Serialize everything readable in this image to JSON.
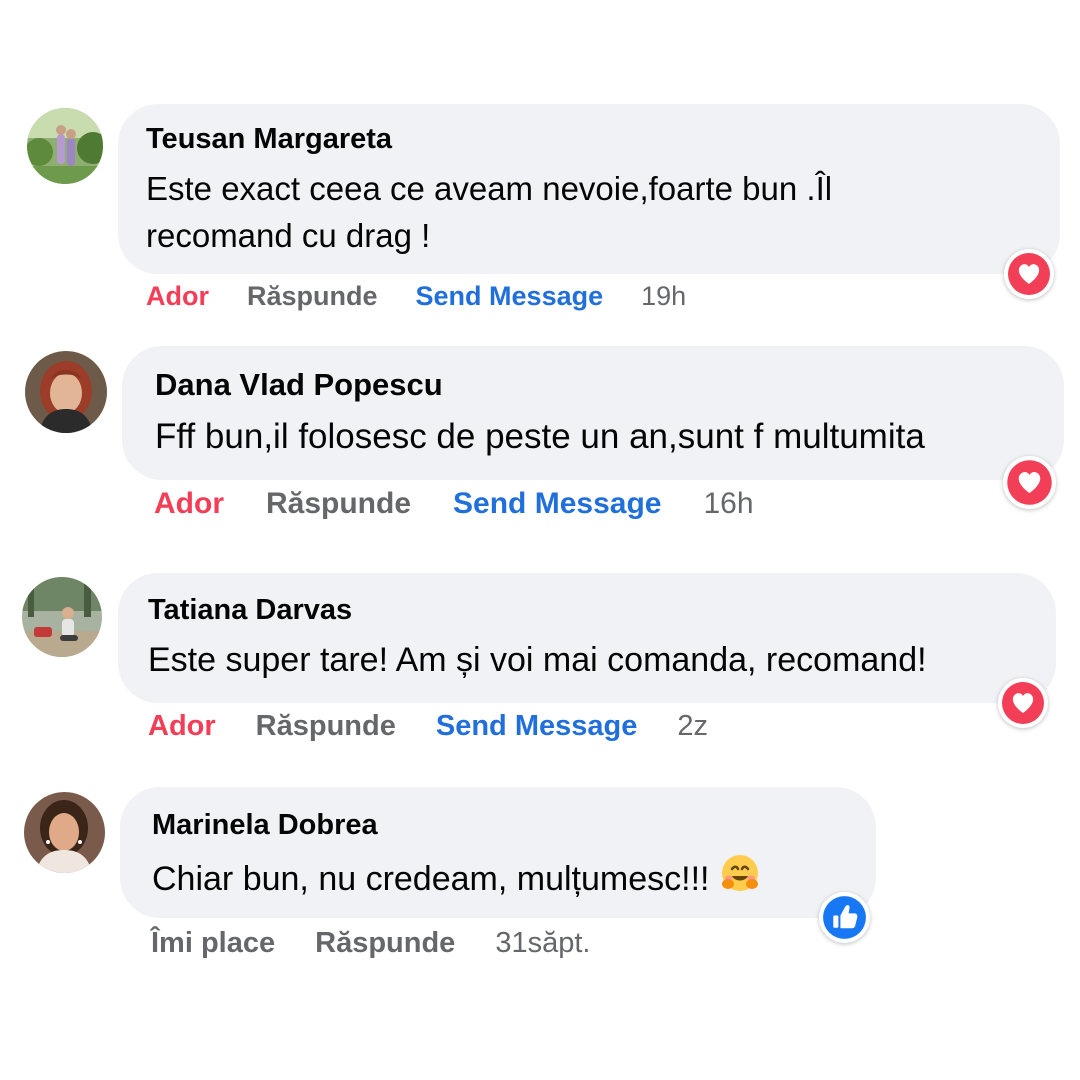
{
  "comments": [
    {
      "author": "Teusan Margareta",
      "text": "Este exact ceea ce aveam nevoie,foarte bun .Îl recomand cu drag !",
      "reaction_icon": "love-reaction-icon",
      "actions": {
        "love": "Ador",
        "reply": "Răspunde",
        "message": "Send Message",
        "time": "19h"
      }
    },
    {
      "author": "Dana Vlad Popescu",
      "text": "Fff bun,il folosesc de peste un an,sunt f multumita",
      "reaction_icon": "love-reaction-icon",
      "actions": {
        "love": "Ador",
        "reply": "Răspunde",
        "message": "Send Message",
        "time": "16h"
      }
    },
    {
      "author": "Tatiana Darvas",
      "text": "Este super tare! Am și voi mai comanda, recomand!",
      "reaction_icon": "love-reaction-icon",
      "actions": {
        "love": "Ador",
        "reply": "Răspunde",
        "message": "Send Message",
        "time": "2z"
      }
    },
    {
      "author": "Marinela Dobrea",
      "text": "Chiar bun, nu credeam, mulțumesc!!!",
      "emoji": "🤗",
      "reaction_icon": "like-reaction-icon",
      "actions": {
        "like": "Îmi place",
        "reply": "Răspunde",
        "time": "31săpt."
      }
    }
  ],
  "colors": {
    "bubble": "#f0f2f5",
    "love": "#f33e58",
    "message_link": "#216fdb",
    "muted": "#65676b",
    "like_blue": "#1877f2"
  }
}
